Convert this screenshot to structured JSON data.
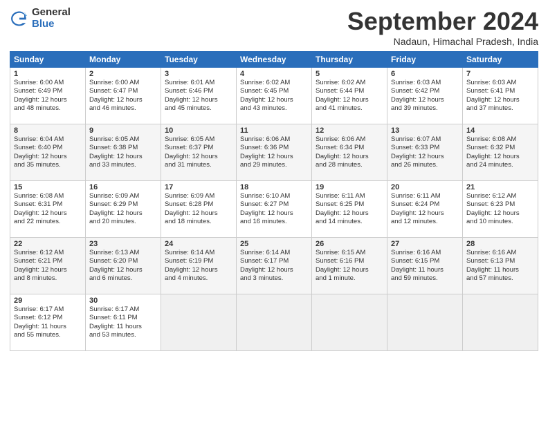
{
  "header": {
    "logo_general": "General",
    "logo_blue": "Blue",
    "month_title": "September 2024",
    "location": "Nadaun, Himachal Pradesh, India"
  },
  "days_of_week": [
    "Sunday",
    "Monday",
    "Tuesday",
    "Wednesday",
    "Thursday",
    "Friday",
    "Saturday"
  ],
  "weeks": [
    [
      {
        "day": "1",
        "lines": [
          "Sunrise: 6:00 AM",
          "Sunset: 6:49 PM",
          "Daylight: 12 hours",
          "and 48 minutes."
        ]
      },
      {
        "day": "2",
        "lines": [
          "Sunrise: 6:00 AM",
          "Sunset: 6:47 PM",
          "Daylight: 12 hours",
          "and 46 minutes."
        ]
      },
      {
        "day": "3",
        "lines": [
          "Sunrise: 6:01 AM",
          "Sunset: 6:46 PM",
          "Daylight: 12 hours",
          "and 45 minutes."
        ]
      },
      {
        "day": "4",
        "lines": [
          "Sunrise: 6:02 AM",
          "Sunset: 6:45 PM",
          "Daylight: 12 hours",
          "and 43 minutes."
        ]
      },
      {
        "day": "5",
        "lines": [
          "Sunrise: 6:02 AM",
          "Sunset: 6:44 PM",
          "Daylight: 12 hours",
          "and 41 minutes."
        ]
      },
      {
        "day": "6",
        "lines": [
          "Sunrise: 6:03 AM",
          "Sunset: 6:42 PM",
          "Daylight: 12 hours",
          "and 39 minutes."
        ]
      },
      {
        "day": "7",
        "lines": [
          "Sunrise: 6:03 AM",
          "Sunset: 6:41 PM",
          "Daylight: 12 hours",
          "and 37 minutes."
        ]
      }
    ],
    [
      {
        "day": "8",
        "lines": [
          "Sunrise: 6:04 AM",
          "Sunset: 6:40 PM",
          "Daylight: 12 hours",
          "and 35 minutes."
        ]
      },
      {
        "day": "9",
        "lines": [
          "Sunrise: 6:05 AM",
          "Sunset: 6:38 PM",
          "Daylight: 12 hours",
          "and 33 minutes."
        ]
      },
      {
        "day": "10",
        "lines": [
          "Sunrise: 6:05 AM",
          "Sunset: 6:37 PM",
          "Daylight: 12 hours",
          "and 31 minutes."
        ]
      },
      {
        "day": "11",
        "lines": [
          "Sunrise: 6:06 AM",
          "Sunset: 6:36 PM",
          "Daylight: 12 hours",
          "and 29 minutes."
        ]
      },
      {
        "day": "12",
        "lines": [
          "Sunrise: 6:06 AM",
          "Sunset: 6:34 PM",
          "Daylight: 12 hours",
          "and 28 minutes."
        ]
      },
      {
        "day": "13",
        "lines": [
          "Sunrise: 6:07 AM",
          "Sunset: 6:33 PM",
          "Daylight: 12 hours",
          "and 26 minutes."
        ]
      },
      {
        "day": "14",
        "lines": [
          "Sunrise: 6:08 AM",
          "Sunset: 6:32 PM",
          "Daylight: 12 hours",
          "and 24 minutes."
        ]
      }
    ],
    [
      {
        "day": "15",
        "lines": [
          "Sunrise: 6:08 AM",
          "Sunset: 6:31 PM",
          "Daylight: 12 hours",
          "and 22 minutes."
        ]
      },
      {
        "day": "16",
        "lines": [
          "Sunrise: 6:09 AM",
          "Sunset: 6:29 PM",
          "Daylight: 12 hours",
          "and 20 minutes."
        ]
      },
      {
        "day": "17",
        "lines": [
          "Sunrise: 6:09 AM",
          "Sunset: 6:28 PM",
          "Daylight: 12 hours",
          "and 18 minutes."
        ]
      },
      {
        "day": "18",
        "lines": [
          "Sunrise: 6:10 AM",
          "Sunset: 6:27 PM",
          "Daylight: 12 hours",
          "and 16 minutes."
        ]
      },
      {
        "day": "19",
        "lines": [
          "Sunrise: 6:11 AM",
          "Sunset: 6:25 PM",
          "Daylight: 12 hours",
          "and 14 minutes."
        ]
      },
      {
        "day": "20",
        "lines": [
          "Sunrise: 6:11 AM",
          "Sunset: 6:24 PM",
          "Daylight: 12 hours",
          "and 12 minutes."
        ]
      },
      {
        "day": "21",
        "lines": [
          "Sunrise: 6:12 AM",
          "Sunset: 6:23 PM",
          "Daylight: 12 hours",
          "and 10 minutes."
        ]
      }
    ],
    [
      {
        "day": "22",
        "lines": [
          "Sunrise: 6:12 AM",
          "Sunset: 6:21 PM",
          "Daylight: 12 hours",
          "and 8 minutes."
        ]
      },
      {
        "day": "23",
        "lines": [
          "Sunrise: 6:13 AM",
          "Sunset: 6:20 PM",
          "Daylight: 12 hours",
          "and 6 minutes."
        ]
      },
      {
        "day": "24",
        "lines": [
          "Sunrise: 6:14 AM",
          "Sunset: 6:19 PM",
          "Daylight: 12 hours",
          "and 4 minutes."
        ]
      },
      {
        "day": "25",
        "lines": [
          "Sunrise: 6:14 AM",
          "Sunset: 6:17 PM",
          "Daylight: 12 hours",
          "and 3 minutes."
        ]
      },
      {
        "day": "26",
        "lines": [
          "Sunrise: 6:15 AM",
          "Sunset: 6:16 PM",
          "Daylight: 12 hours",
          "and 1 minute."
        ]
      },
      {
        "day": "27",
        "lines": [
          "Sunrise: 6:16 AM",
          "Sunset: 6:15 PM",
          "Daylight: 11 hours",
          "and 59 minutes."
        ]
      },
      {
        "day": "28",
        "lines": [
          "Sunrise: 6:16 AM",
          "Sunset: 6:13 PM",
          "Daylight: 11 hours",
          "and 57 minutes."
        ]
      }
    ],
    [
      {
        "day": "29",
        "lines": [
          "Sunrise: 6:17 AM",
          "Sunset: 6:12 PM",
          "Daylight: 11 hours",
          "and 55 minutes."
        ]
      },
      {
        "day": "30",
        "lines": [
          "Sunrise: 6:17 AM",
          "Sunset: 6:11 PM",
          "Daylight: 11 hours",
          "and 53 minutes."
        ]
      },
      null,
      null,
      null,
      null,
      null
    ]
  ]
}
